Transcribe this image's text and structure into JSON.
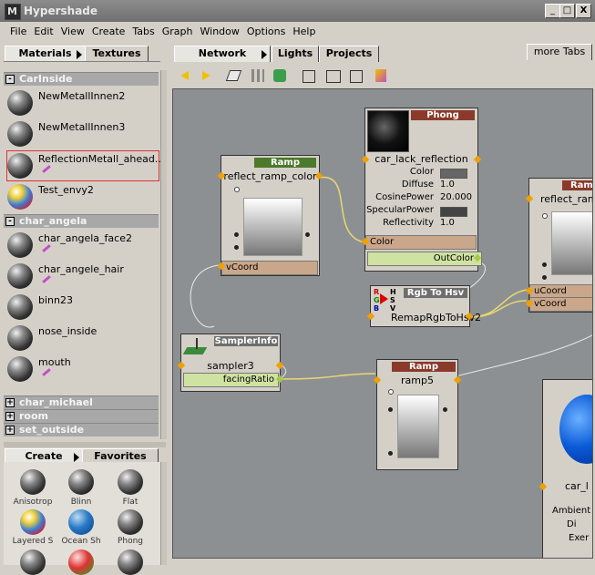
{
  "window": {
    "title": "Hypershade",
    "logo": "M",
    "min_label": "_",
    "max_label": "□",
    "close_label": "X"
  },
  "menu": [
    "File",
    "Edit",
    "View",
    "Create",
    "Tabs",
    "Graph",
    "Window",
    "Options",
    "Help"
  ],
  "left_tabs": {
    "materials": "Materials",
    "textures": "Textures"
  },
  "right_tabs": {
    "network": "Network",
    "lights": "Lights",
    "projects": "Projects",
    "more": "more Tabs"
  },
  "groups": {
    "carinside": {
      "name": "CarInside",
      "sign": "-"
    },
    "char_angela": {
      "name": "char_angela",
      "sign": "-"
    },
    "char_michael": {
      "name": "char_michael",
      "sign": "+"
    },
    "room": {
      "name": "room",
      "sign": "+"
    },
    "set_outside": {
      "name": "set_outside",
      "sign": "+"
    }
  },
  "carinside_items": [
    "NewMetallInnen2",
    "NewMetallInnen3",
    "ReflectionMetall_ahead...",
    "Test_envy2"
  ],
  "angela_items": [
    "char_angela_face2",
    "char_angele_hair",
    "binn23",
    "nose_inside",
    "mouth"
  ],
  "create_tabs": {
    "create": "Create",
    "favorites": "Favorites"
  },
  "create_items": [
    "Anisotrop",
    "Blinn",
    "Flat",
    "Layered S",
    "Ocean Sh",
    "Phong"
  ],
  "nodes": {
    "ramp1": {
      "type": "Ramp",
      "name": "reflect_ramp_color",
      "attr": "vCoord"
    },
    "phong": {
      "type": "Phong",
      "name": "car_lack_reflection",
      "color_attr": "Color",
      "out": "OutColor",
      "params": [
        {
          "k": "Color",
          "v": ""
        },
        {
          "k": "Diffuse",
          "v": "1.0"
        },
        {
          "k": "CosinePower",
          "v": "20.000"
        },
        {
          "k": "SpecularPower",
          "v": ""
        },
        {
          "k": "Reflectivity",
          "v": "1.0"
        }
      ]
    },
    "ramp_right": {
      "type": "Ramp",
      "name": "reflect_ram",
      "u": "uCoord",
      "v": "vCoord"
    },
    "rgbhsv": {
      "type": "Rgb To Hsv",
      "name": "RemapRgbToHsv2",
      "r": "R",
      "g": "G",
      "b": "B",
      "h": "H",
      "s": "S",
      "vv": "V"
    },
    "sampler": {
      "type": "SamplerInfo",
      "name": "sampler3",
      "out": "facingRatio"
    },
    "ramp5": {
      "type": "Ramp",
      "name": "ramp5"
    },
    "blinn_partial": {
      "name": "car_l",
      "params": [
        "Ambient",
        "Di",
        "Exer"
      ]
    }
  },
  "colors": {
    "graph_bg": "#8d9093",
    "ramp_hdr": "#4c7a2c",
    "phong_hdr": "#8a3a2a",
    "wire_yellow": "#e8d870",
    "wire_white": "#e8e8e8"
  }
}
